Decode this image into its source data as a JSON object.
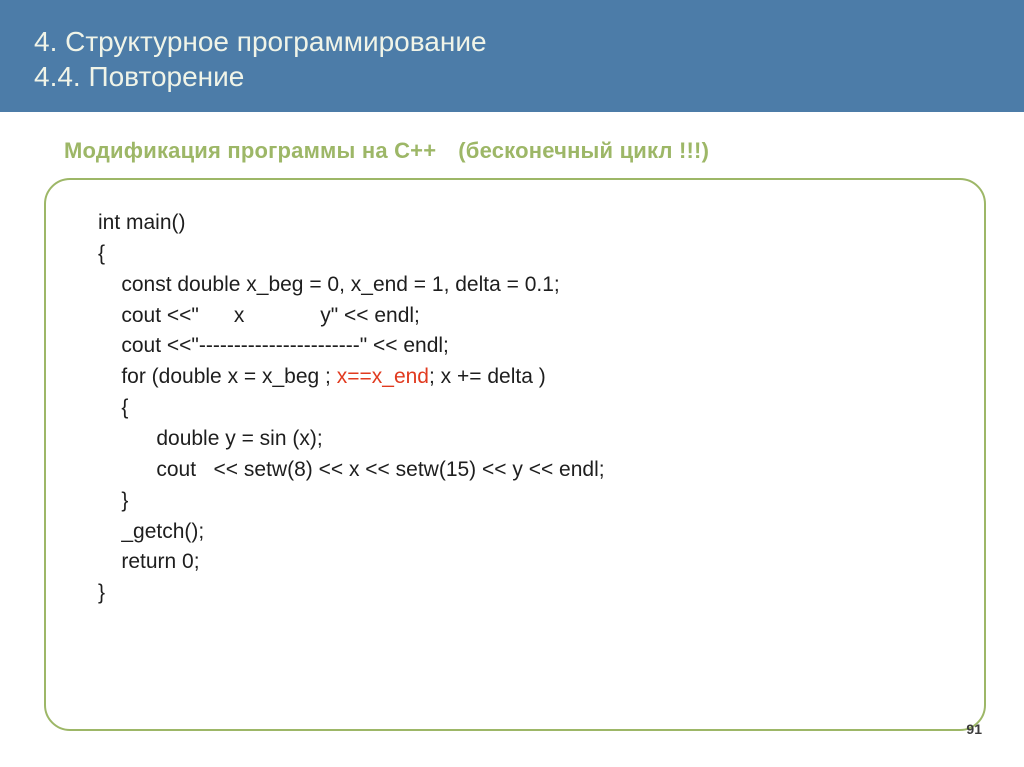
{
  "header": {
    "line1": "4. Структурное программирование",
    "line2": "4.4. Повторение"
  },
  "subtitle": {
    "part1": "Модификация программы на C++",
    "part2": "(бесконечный  цикл !!!)"
  },
  "code": {
    "l1": "int main()",
    "l2": "{",
    "l3": "    const double x_beg = 0, x_end = 1, delta = 0.1;",
    "l4": "    cout <<\"      x             y\" << endl;",
    "l5": "    cout <<\"-----------------------\" << endl;",
    "l6a": "    for (double x = x_beg ; ",
    "l6_hl": "x==x_end",
    "l6b": "; x += delta )",
    "l7": "    {",
    "l8": "          double y = sin (x);",
    "l9": "          cout   << setw(8) << x << setw(15) << y << endl;",
    "l10": "    }",
    "l11": "    _getch();",
    "l12": "    return 0;",
    "l13": "}"
  },
  "page_number": "91"
}
